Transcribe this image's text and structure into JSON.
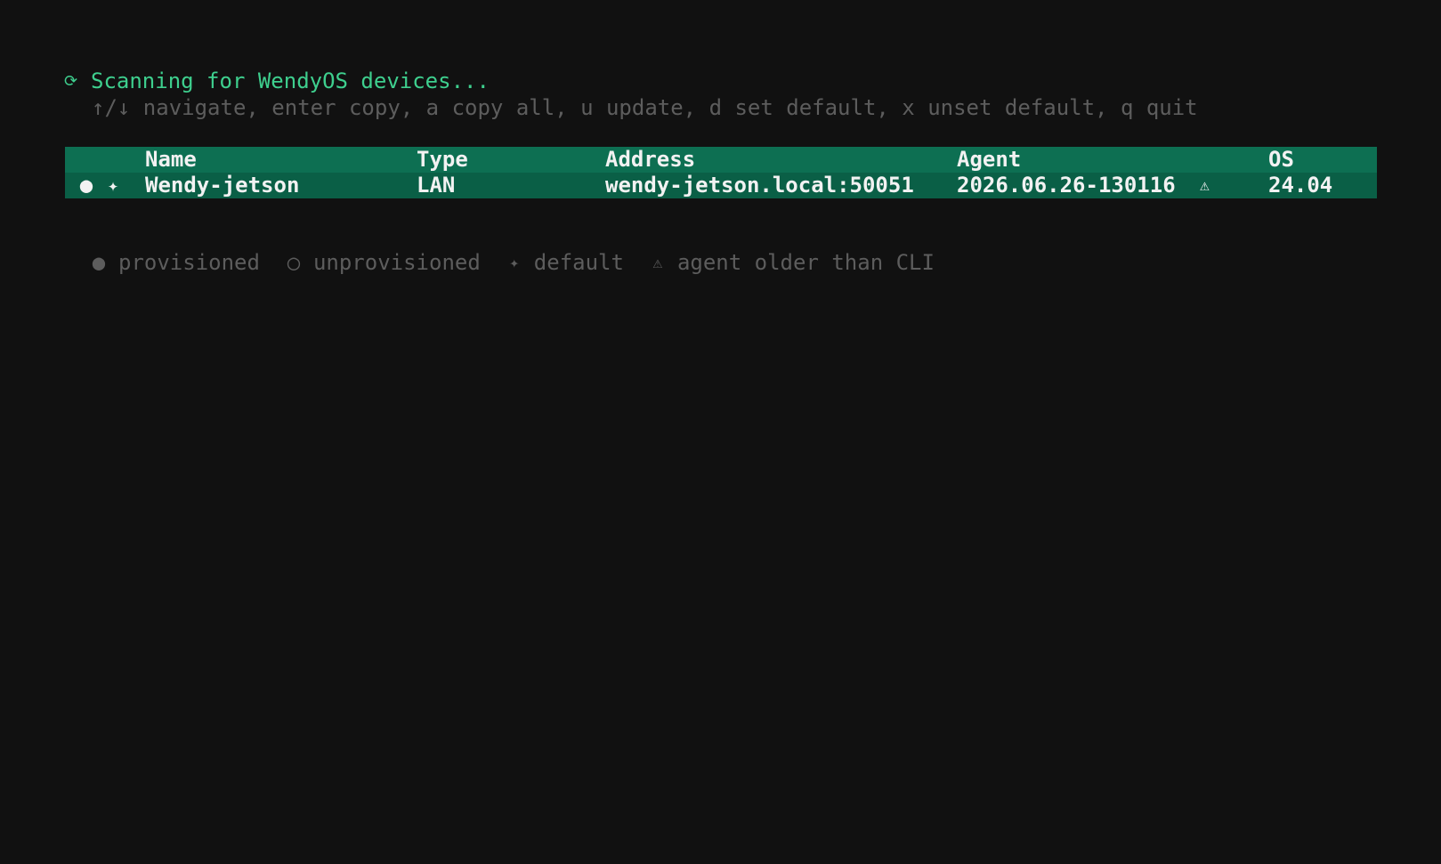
{
  "status": {
    "spinner_icon": "spinner-icon",
    "spinner_glyph": "⟳",
    "text": "Scanning for WendyOS devices..."
  },
  "help": {
    "text": "↑/↓ navigate, enter copy, a copy all, u update, d set default, x unset default, q quit"
  },
  "table": {
    "columns": {
      "name": "Name",
      "type": "Type",
      "address": "Address",
      "agent": "Agent",
      "os": "OS"
    },
    "rows": [
      {
        "status_glyph": "●",
        "default_glyph": "✦",
        "name": "Wendy-jetson",
        "type": "LAN",
        "address": "wendy-jetson.local:50051",
        "agent": "2026.06.26-130116",
        "warning_glyph": "⚠",
        "os": "24.04"
      }
    ]
  },
  "legend": {
    "provisioned": {
      "glyph": "●",
      "label": "provisioned"
    },
    "unprovisioned": {
      "glyph": "○",
      "label": "unprovisioned"
    },
    "default": {
      "glyph": "✦",
      "label": "default"
    },
    "agent_older": {
      "glyph": "⚠",
      "label": "agent older than CLI"
    }
  },
  "colors": {
    "background": "#111111",
    "accent": "#3ecf8e",
    "selected_row": "#0b6b4f",
    "muted_text": "#5d5d5d"
  }
}
